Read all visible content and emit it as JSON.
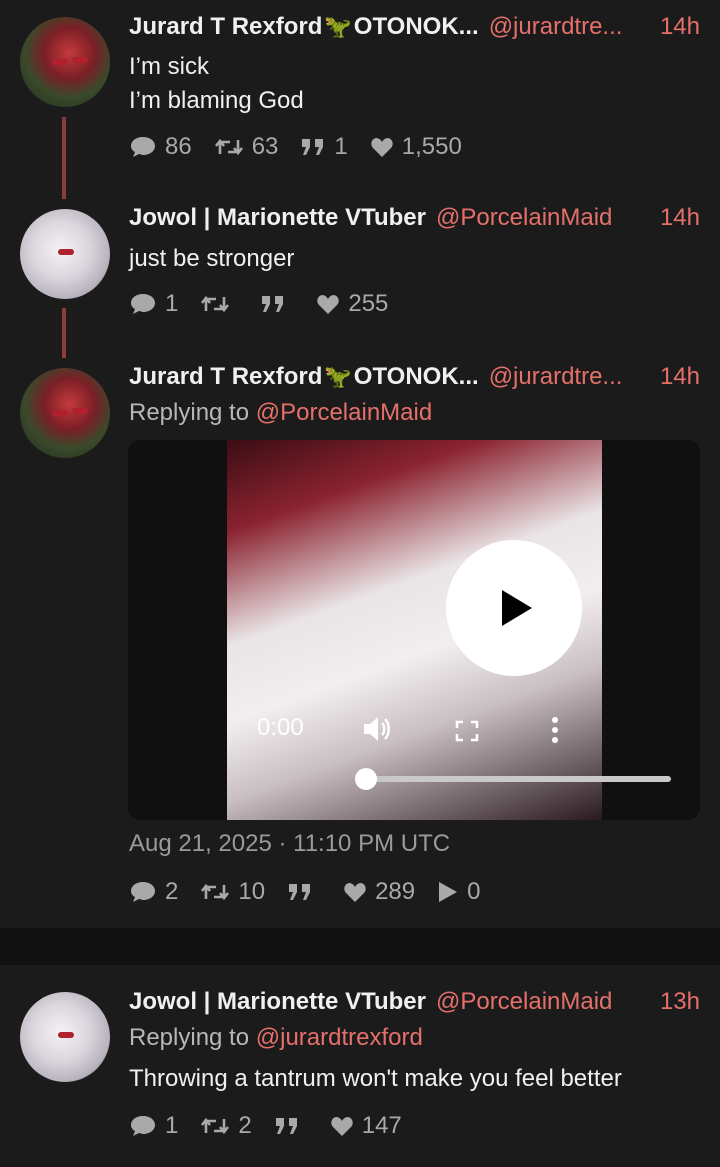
{
  "tweet1": {
    "name": "Jurard T Rexford",
    "dino": "🦖",
    "name_suffix": "OTONOK...",
    "handle": "@jurardtre...",
    "time": "14h",
    "lines": [
      "I’m sick",
      "I’m blaming God"
    ],
    "stats": {
      "replies": "86",
      "retweets": "63",
      "quotes": "1",
      "likes": "1,550"
    }
  },
  "tweet2": {
    "name": "Jowol | Marionette VTuber",
    "handle": "@PorcelainMaid",
    "time": "14h",
    "text": "just be stronger",
    "stats": {
      "replies": "1",
      "retweets": "",
      "quotes": "",
      "likes": "255"
    }
  },
  "tweet3": {
    "name": "Jurard T Rexford",
    "dino": "🦖",
    "name_suffix": "OTONOK...",
    "handle": "@jurardtre...",
    "time": "14h",
    "reply_prefix": "Replying to",
    "reply_to": "@PorcelainMaid",
    "video": {
      "time": "0:00",
      "progress": 0
    },
    "date": "Aug 21, 2025 · 11:10 PM UTC",
    "stats": {
      "replies": "2",
      "retweets": "10",
      "quotes": "",
      "likes": "289",
      "plays": "0"
    }
  },
  "tweet4": {
    "name": "Jowol | Marionette VTuber",
    "handle": "@PorcelainMaid",
    "time": "13h",
    "reply_prefix": "Replying to",
    "reply_to": "@jurardtrexford",
    "text": "Throwing a tantrum won't make you feel better",
    "stats": {
      "replies": "1",
      "retweets": "2",
      "quotes": "",
      "likes": "147"
    }
  },
  "colors": {
    "accent": "#e5706a",
    "thread_line": "#8e3a36",
    "background": "#1b1b1b"
  }
}
